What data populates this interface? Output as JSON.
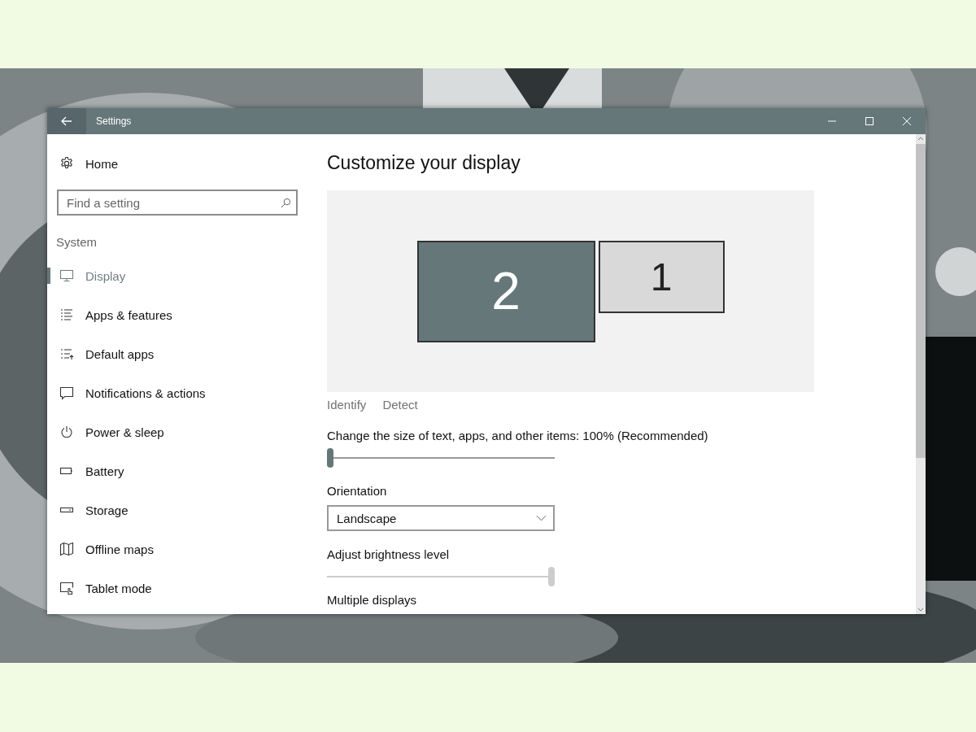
{
  "window": {
    "title": "Settings"
  },
  "sidebar": {
    "home": "Home",
    "search": {
      "placeholder": "Find a setting"
    },
    "section": "System",
    "items": [
      {
        "label": "Display",
        "kind": "display",
        "selected": true
      },
      {
        "label": "Apps & features",
        "kind": "list",
        "selected": false
      },
      {
        "label": "Default apps",
        "kind": "defaults",
        "selected": false
      },
      {
        "label": "Notifications & actions",
        "kind": "notifications",
        "selected": false
      },
      {
        "label": "Power & sleep",
        "kind": "power",
        "selected": false
      },
      {
        "label": "Battery",
        "kind": "battery",
        "selected": false
      },
      {
        "label": "Storage",
        "kind": "storage",
        "selected": false
      },
      {
        "label": "Offline maps",
        "kind": "map",
        "selected": false
      },
      {
        "label": "Tablet mode",
        "kind": "tablet",
        "selected": false
      }
    ]
  },
  "content": {
    "title": "Customize your display",
    "displays": [
      {
        "number": "2",
        "selected": true
      },
      {
        "number": "1",
        "selected": false
      }
    ],
    "links": [
      "Identify",
      "Detect"
    ],
    "scale": {
      "label": "Change the size of text, apps, and other items: 100% (Recommended)",
      "level": 0,
      "disabled": false
    },
    "orientation": {
      "label": "Orientation",
      "value": "Landscape"
    },
    "brightness": {
      "label": "Adjust brightness level",
      "level": 1,
      "disabled": true
    },
    "next_section": "Multiple displays"
  }
}
